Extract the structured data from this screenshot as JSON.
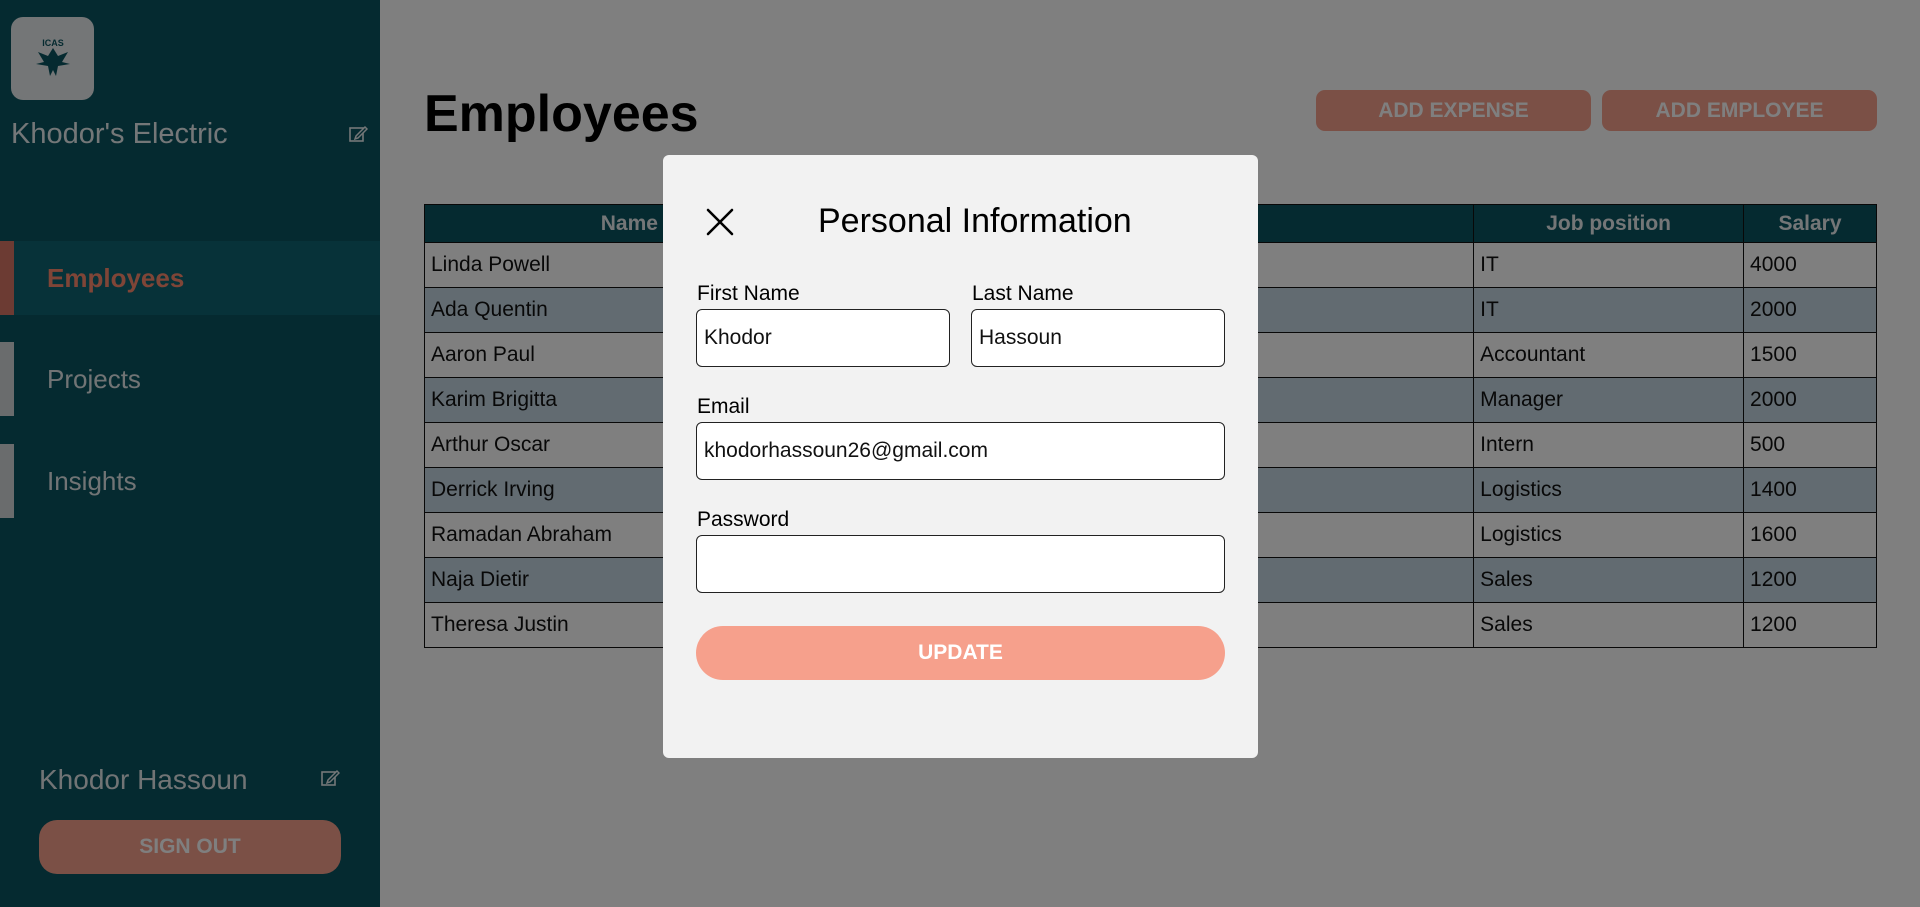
{
  "sidebar": {
    "logo_text": "ICAS",
    "company_name": "Khodor's Electric",
    "nav": [
      {
        "label": "Employees",
        "active": true
      },
      {
        "label": "Projects",
        "active": false
      },
      {
        "label": "Insights",
        "active": false
      }
    ],
    "user_name": "Khodor Hassoun",
    "sign_out_label": "SIGN OUT"
  },
  "main": {
    "title": "Employees",
    "add_expense_label": "ADD EXPENSE",
    "add_employee_label": "ADD EMPLOYEE",
    "table": {
      "headers": [
        "Name",
        "",
        "Job position",
        "Salary"
      ],
      "rows": [
        {
          "name": "Linda Powell",
          "position": "IT",
          "salary": "4000"
        },
        {
          "name": "Ada Quentin",
          "position": "IT",
          "salary": "2000"
        },
        {
          "name": "Aaron Paul",
          "position": "Accountant",
          "salary": "1500"
        },
        {
          "name": "Karim Brigitta",
          "position": "Manager",
          "salary": "2000"
        },
        {
          "name": "Arthur Oscar",
          "position": "Intern",
          "salary": "500"
        },
        {
          "name": "Derrick Irving",
          "position": "Logistics",
          "salary": "1400"
        },
        {
          "name": "Ramadan Abraham",
          "position": "Logistics",
          "salary": "1600"
        },
        {
          "name": "Naja Dietir",
          "position": "Sales",
          "salary": "1200"
        },
        {
          "name": "Theresa Justin",
          "position": "Sales",
          "salary": "1200"
        }
      ]
    }
  },
  "modal": {
    "title": "Personal Information",
    "first_name_label": "First Name",
    "first_name_value": "Khodor",
    "last_name_label": "Last Name",
    "last_name_value": "Hassoun",
    "email_label": "Email",
    "email_value": "khodorhassoun26@gmail.com",
    "password_label": "Password",
    "password_value": "",
    "update_label": "UPDATE"
  },
  "colors": {
    "sidebar_bg": "#0b5560",
    "accent": "#f6a08c",
    "active_nav_text": "#ff8a6e",
    "row_alt": "#c4d6e2"
  }
}
